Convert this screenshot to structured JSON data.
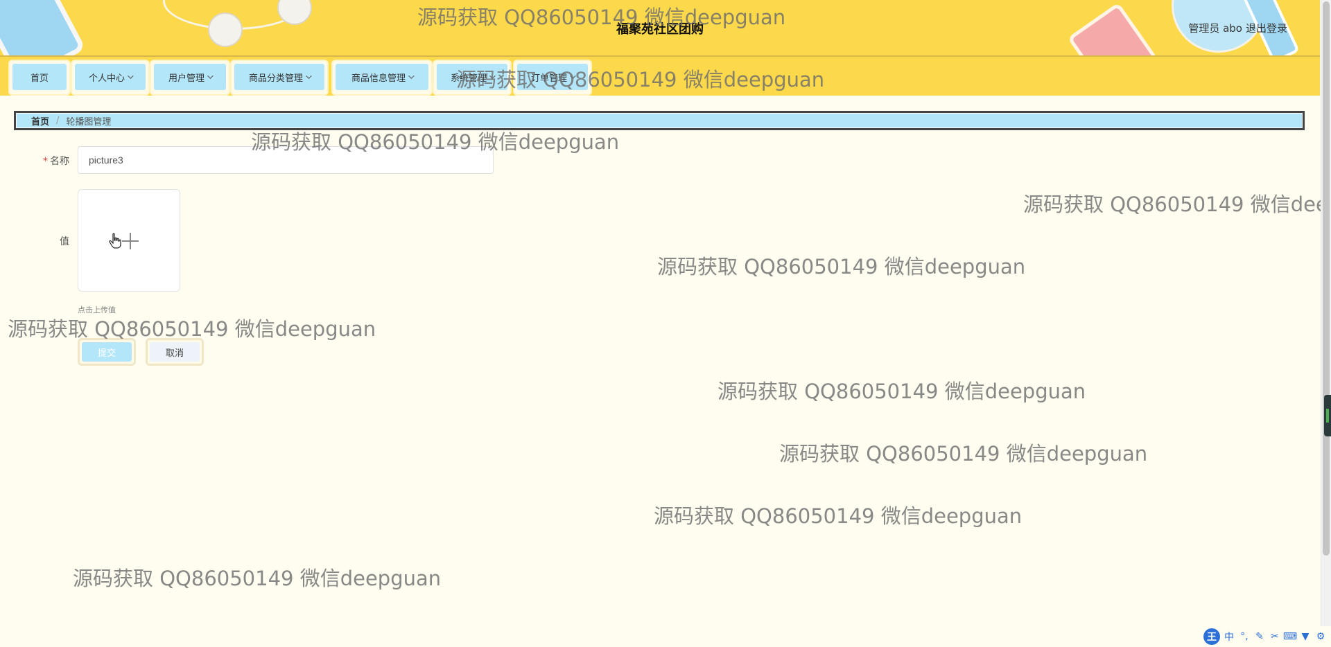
{
  "header": {
    "site_title": "福聚苑社区团购",
    "user_label": "管理员 abo",
    "logout_label": "退出登录"
  },
  "nav": {
    "items": [
      {
        "label": "首页",
        "has_dropdown": false
      },
      {
        "label": "个人中心",
        "has_dropdown": true
      },
      {
        "label": "用户管理",
        "has_dropdown": true
      },
      {
        "label": "商品分类管理",
        "has_dropdown": true
      },
      {
        "label": "商品信息管理",
        "has_dropdown": true
      },
      {
        "label": "系统管理",
        "has_dropdown": true
      },
      {
        "label": "订单管理",
        "has_dropdown": true
      }
    ]
  },
  "breadcrumb": {
    "home": "首页",
    "separator": "/",
    "current": "轮播图管理"
  },
  "form": {
    "name_label": "名称",
    "name_required_mark": "*",
    "name_value": "picture3",
    "value_label": "值",
    "upload_tip": "点击上传值",
    "submit_label": "提交",
    "cancel_label": "取消"
  },
  "watermark": {
    "text": "源码获取 QQ86050149 微信deepguan"
  },
  "ime_toolbar": {
    "logo": "王",
    "lang": "中",
    "icons": [
      "punctuation-icon",
      "pen-icon",
      "scissors-icon",
      "keyboard-icon",
      "shirt-icon",
      "gear-icon"
    ]
  },
  "colors": {
    "header_bg": "#fcd94a",
    "nav_button_bg": "#b3e6f8",
    "page_bg": "#fffdf0",
    "required": "#e04a4a"
  }
}
